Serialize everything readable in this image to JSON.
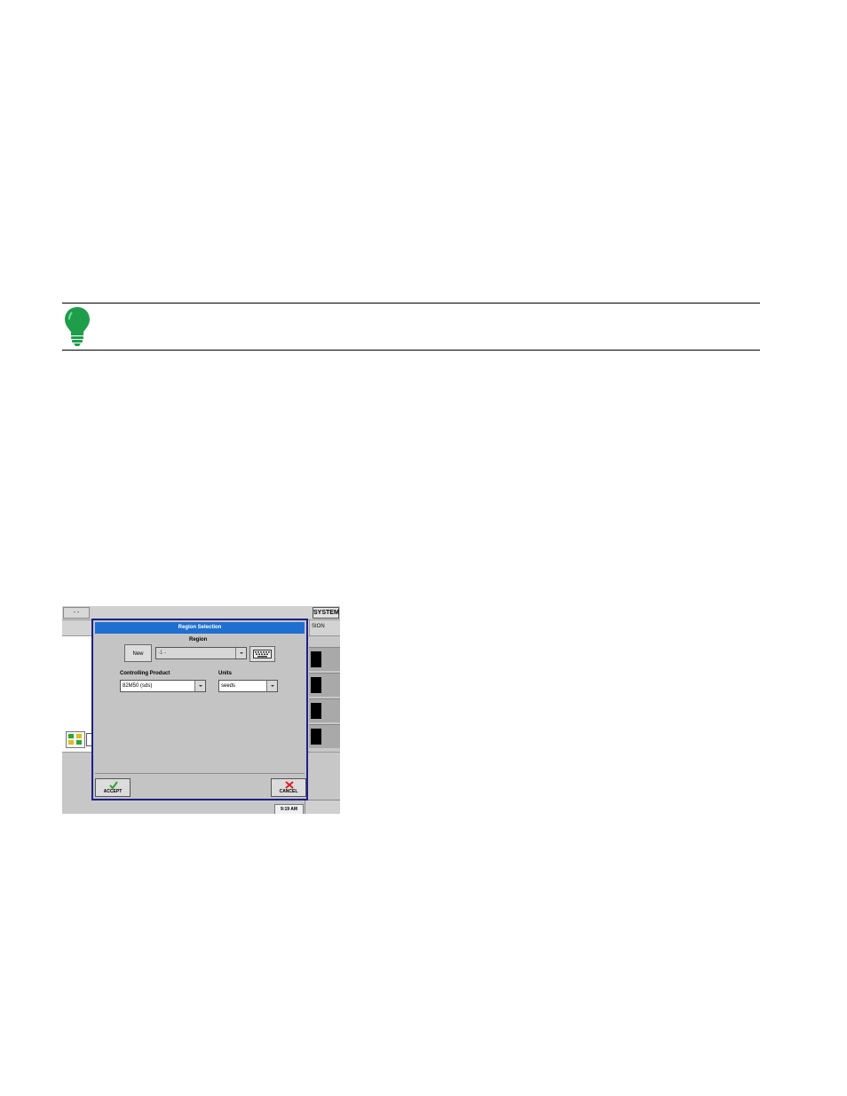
{
  "dialog": {
    "title": "Region Selection",
    "region_label": "Region",
    "new_button": "New",
    "region_value": "-1 -",
    "controlling_product_label": "Controlling Product",
    "controlling_product_value": "82M50 (sds)",
    "units_label": "Units",
    "units_value": "seeds",
    "accept_button": "ACCEPT",
    "cancel_button": "CANCEL"
  },
  "background": {
    "top_left_button": "- -",
    "system_button": "SYSTEM",
    "header_right_label": "SION"
  },
  "status": {
    "clock": "9:19 AM"
  },
  "colors": {
    "title_bar": "#1e6fd0",
    "dialog_border": "#1f1f8a",
    "accept_check": "#2fa52f",
    "cancel_x": "#e02020",
    "tip_bulb": "#1e9e4a"
  }
}
